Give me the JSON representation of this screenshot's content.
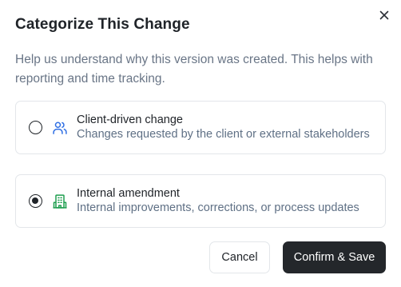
{
  "dialog": {
    "title": "Categorize This Change",
    "description": "Help us understand why this version was created. This helps with reporting and time tracking.",
    "close_icon": "close-icon"
  },
  "options": [
    {
      "title": "Client-driven change",
      "subtitle": "Changes requested by the client or external stakeholders",
      "icon": "users-icon",
      "icon_color": "#2f6fe4",
      "selected": false
    },
    {
      "title": "Internal amendment",
      "subtitle": "Internal improvements, corrections, or process updates",
      "icon": "building-icon",
      "icon_color": "#1e9e4f",
      "selected": true
    }
  ],
  "buttons": {
    "cancel_label": "Cancel",
    "confirm_label": "Confirm & Save"
  },
  "colors": {
    "primary_button": "#24272b",
    "muted_text": "#697586",
    "border": "#e3e6ea"
  }
}
